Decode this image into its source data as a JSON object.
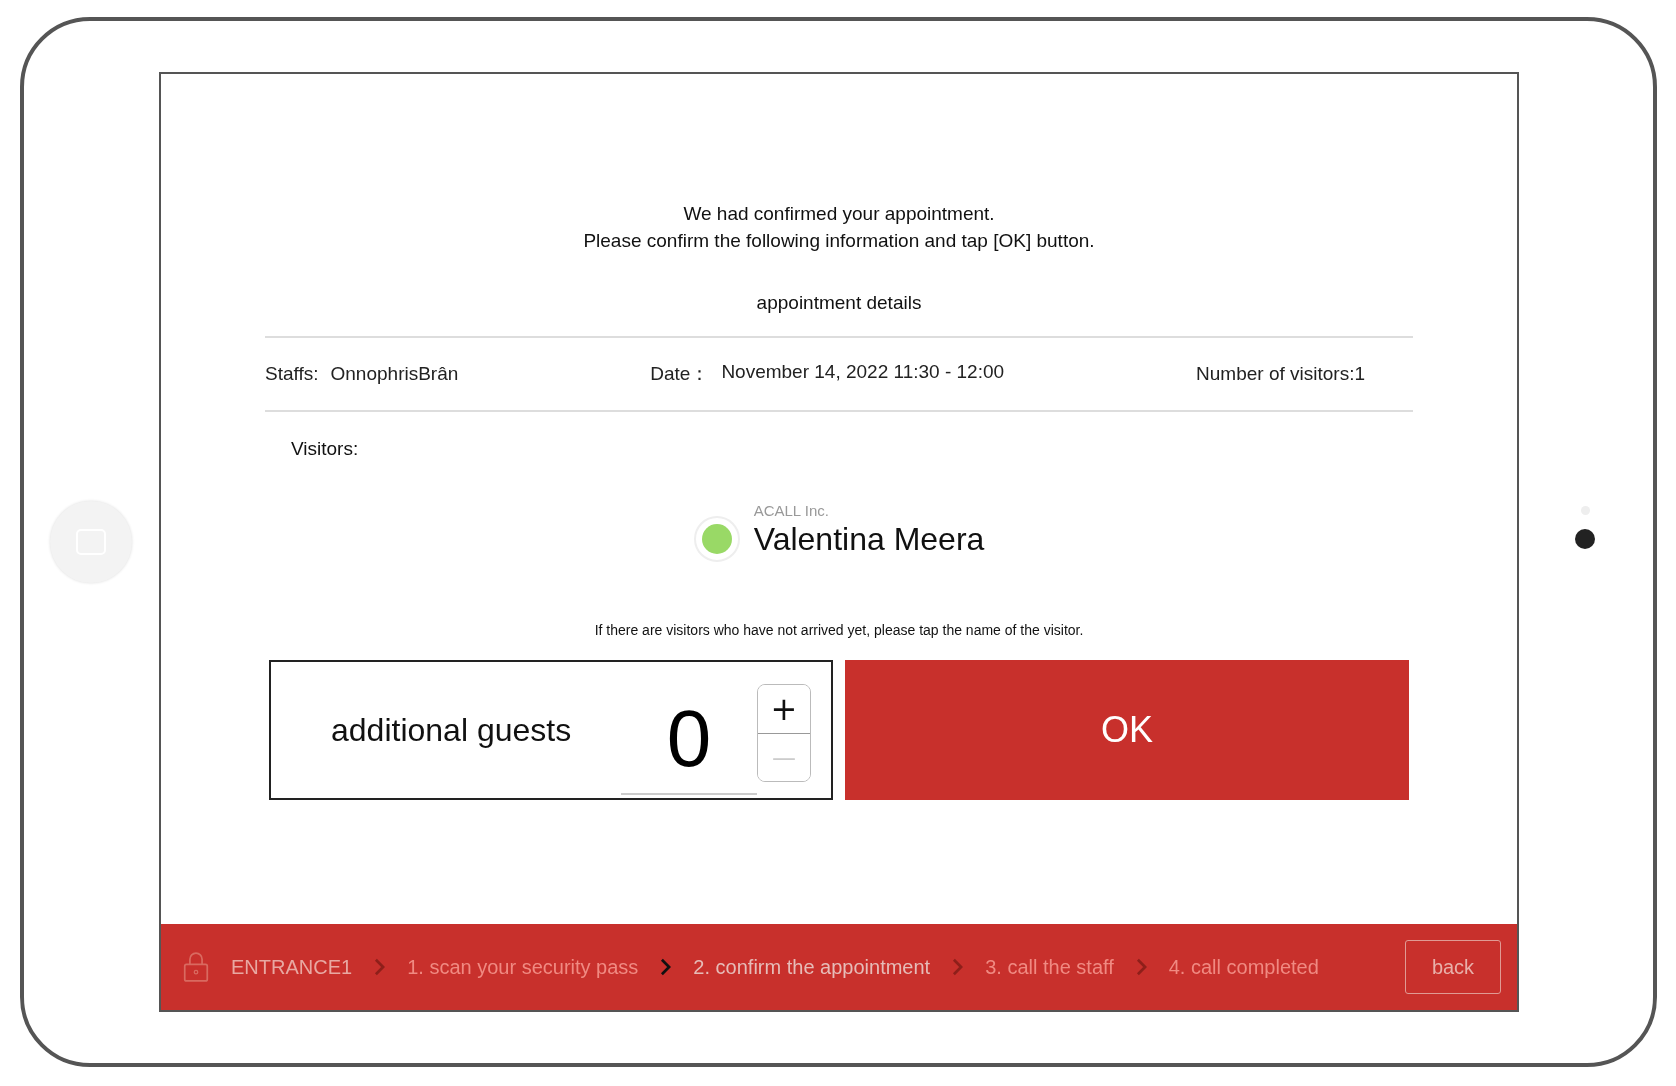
{
  "message": [
    "We had confirmed your appointment.",
    "Please confirm the following information and tap [OK] button."
  ],
  "details_title": "appointment details",
  "details": [
    {
      "label": "Staffs:",
      "value": "OnnophrisBrân"
    },
    {
      "label": "Date：",
      "value": "November 14, 2022 11:30 - 12:00"
    },
    {
      "label": "Number of visitors:1"
    }
  ],
  "visitors_label": "Visitors:",
  "visitors": [
    {
      "company": "ACALL Inc.",
      "name": "Valentina Meera",
      "color": "#99d966"
    }
  ],
  "hint": "If there are visitors who have not arrived yet, please tap the name of the visitor.",
  "guests": {
    "label": "additional guests",
    "value": "0",
    "buttons": [
      {
        "symbol": "+",
        "disabled": false
      },
      {
        "symbol": "—",
        "disabled": true
      }
    ]
  },
  "ok_button": "OK",
  "footer": {
    "location": "ENTRANCE1",
    "steps": [
      {
        "label": "1. scan your security pass",
        "selected": false
      },
      {
        "label": "2. confirm the appointment",
        "selected": true
      },
      {
        "label": "3. call the staff",
        "selected": false
      },
      {
        "label": "4. call completed",
        "selected": false
      }
    ],
    "back_button": "back"
  }
}
